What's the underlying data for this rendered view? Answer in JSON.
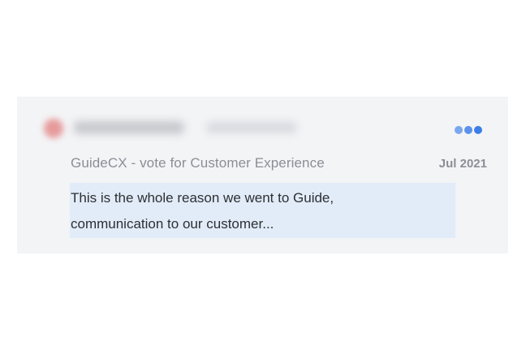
{
  "review": {
    "author_name": "",
    "author_company": "",
    "source_title": "GuideCX - vote for Customer Experience",
    "date": "Jul 2021",
    "quote_lines": [
      "This is the whole reason we went to Guide,",
      "communication to our customer..."
    ]
  },
  "icons": {
    "avatar": "user-avatar",
    "more": "more-dots-icon"
  },
  "colors": {
    "card_background": "#f3f4f6",
    "quote_highlight": "#e2ecf8",
    "muted_text": "#8b8e95",
    "body_text": "#2d2f33",
    "dots": [
      "#7aa7ef",
      "#5b92ec",
      "#3d7de8"
    ]
  }
}
